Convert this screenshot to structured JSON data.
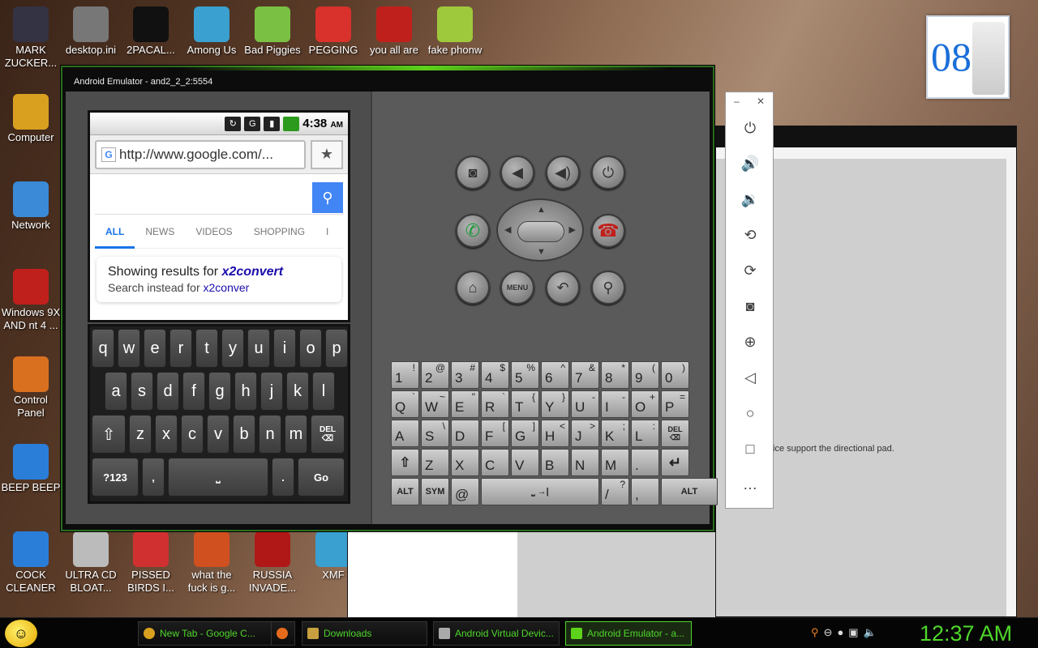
{
  "desktop": {
    "top_icons": [
      {
        "label": "MARK ZUCKER...",
        "icon": "user-figure-icon"
      },
      {
        "label": "desktop.ini",
        "icon": "settings-file-icon"
      },
      {
        "label": "2PACAL...",
        "icon": "console-icon"
      },
      {
        "label": "Among Us",
        "icon": "app-icon"
      },
      {
        "label": "Bad Piggies",
        "icon": "pig-icon"
      },
      {
        "label": "PEGGING",
        "icon": "p-logo-icon"
      },
      {
        "label": "you all are",
        "icon": "devcpp-icon"
      },
      {
        "label": "fake phonw",
        "icon": "android-icon"
      }
    ],
    "left_icons": [
      {
        "label": "Computer",
        "icon": "computer-icon"
      },
      {
        "label": "Network",
        "icon": "network-icon"
      },
      {
        "label": "Windows 9X AND nt 4 ...",
        "icon": "recycle-bin-icon"
      },
      {
        "label": "Control Panel",
        "icon": "control-panel-icon"
      },
      {
        "label": "BEEP BEEP",
        "icon": "shortcut-icon"
      }
    ],
    "bottom_icons": [
      {
        "label": "COCK CLEANER",
        "icon": "shortcut-icon"
      },
      {
        "label": "ULTRA CD BLOAT...",
        "icon": "disc-icon"
      },
      {
        "label": "PISSED BIRDS I...",
        "icon": "angry-birds-icon"
      },
      {
        "label": "what the fuck is g...",
        "icon": "angry-birds-space-icon"
      },
      {
        "label": "RUSSIA INVADE...",
        "icon": "radiation-icon"
      },
      {
        "label": "XMF",
        "icon": "app-icon"
      }
    ],
    "clock_widget_number": "08"
  },
  "emulator": {
    "title": "Android Emulator - and2_2_2:5554",
    "status_time": "4:38",
    "status_ampm": "AM",
    "url": "http://www.google.com/...",
    "tabs": [
      "ALL",
      "NEWS",
      "VIDEOS",
      "SHOPPING",
      "I"
    ],
    "result_prefix": "Showing results for ",
    "result_term": "x2convert",
    "instead_prefix": "Search instead for ",
    "instead_term": "x2conver",
    "softkeys": {
      "row1": [
        "q",
        "w",
        "e",
        "r",
        "t",
        "y",
        "u",
        "i",
        "o",
        "p"
      ],
      "row2": [
        "a",
        "s",
        "d",
        "f",
        "g",
        "h",
        "j",
        "k",
        "l"
      ],
      "row3": [
        "z",
        "x",
        "c",
        "v",
        "b",
        "n",
        "m"
      ],
      "sym": "?123",
      "comma": ",",
      "period": ".",
      "go": "Go",
      "del": "DEL"
    },
    "menu_label": "MENU",
    "hard_keys": {
      "row1": [
        [
          "1",
          "!"
        ],
        [
          "2",
          "@"
        ],
        [
          "3",
          "#"
        ],
        [
          "4",
          "$"
        ],
        [
          "5",
          "%"
        ],
        [
          "6",
          "^"
        ],
        [
          "7",
          "&"
        ],
        [
          "8",
          "*"
        ],
        [
          "9",
          "("
        ],
        [
          "0",
          ")"
        ]
      ],
      "row2": [
        [
          "Q",
          "`"
        ],
        [
          "W",
          "~"
        ],
        [
          "E",
          "\""
        ],
        [
          "R",
          "`"
        ],
        [
          "T",
          "{"
        ],
        [
          "Y",
          "}"
        ],
        [
          "U",
          "-"
        ],
        [
          "I",
          "-"
        ],
        [
          "O",
          "+"
        ],
        [
          "P",
          "="
        ]
      ],
      "row3": [
        [
          "A",
          ""
        ],
        [
          "S",
          "\\"
        ],
        [
          "D",
          ""
        ],
        [
          "F",
          "["
        ],
        [
          "G",
          "]"
        ],
        [
          "H",
          "<"
        ],
        [
          "J",
          ">"
        ],
        [
          "K",
          ";"
        ],
        [
          "L",
          ":"
        ]
      ],
      "row4": [
        "Z",
        "X",
        "C",
        "V",
        "B",
        "N",
        "M",
        "."
      ],
      "alt": "ALT",
      "sym": "SYM",
      "at": "@",
      "slash": "/",
      "slash_alt": "?",
      "comma": ",",
      "del": "DEL"
    }
  },
  "background_window": {
    "text": "ice   support the directional pad."
  },
  "taskbar": {
    "items": [
      {
        "label": "New Tab - Google C...",
        "icon": "chrome-icon"
      },
      {
        "label": "",
        "icon": "firefox-icon"
      },
      {
        "label": "Downloads",
        "icon": "folder-icon"
      },
      {
        "label": "Android Virtual Devic...",
        "icon": "avd-icon"
      },
      {
        "label": "Android Emulator - a...",
        "icon": "emulator-icon"
      }
    ],
    "clock": "12:37 AM"
  }
}
